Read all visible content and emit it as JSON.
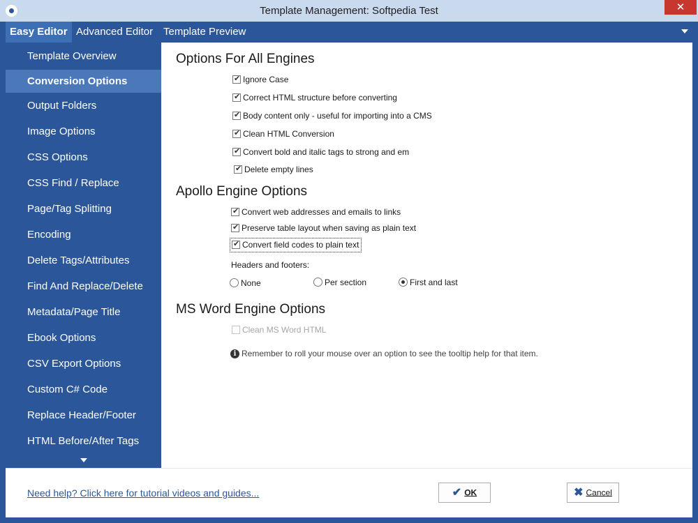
{
  "window": {
    "title": "Template Management: Softpedia Test",
    "close_label": "✕"
  },
  "menu": {
    "tabs": [
      {
        "label": "Easy Editor",
        "active": true
      },
      {
        "label": "Advanced Editor",
        "active": false
      },
      {
        "label": "Template Preview",
        "active": false
      }
    ]
  },
  "sidebar": {
    "items": [
      {
        "label": "Template Overview"
      },
      {
        "label": "Conversion Options",
        "active": true
      },
      {
        "label": "Output Folders"
      },
      {
        "label": "Image Options"
      },
      {
        "label": "CSS Options"
      },
      {
        "label": "CSS Find / Replace"
      },
      {
        "label": "Page/Tag Splitting"
      },
      {
        "label": "Encoding"
      },
      {
        "label": "Delete Tags/Attributes"
      },
      {
        "label": "Find And Replace/Delete"
      },
      {
        "label": "Metadata/Page Title"
      },
      {
        "label": "Ebook Options"
      },
      {
        "label": "CSV Export Options"
      },
      {
        "label": "Custom C# Code"
      },
      {
        "label": "Replace Header/Footer"
      },
      {
        "label": "HTML Before/After Tags"
      }
    ]
  },
  "main": {
    "all_engines": {
      "title": "Options For All Engines",
      "options": [
        {
          "label": "Ignore Case",
          "checked": true
        },
        {
          "label": "Correct HTML structure before converting",
          "checked": true
        },
        {
          "label": "Body content only - useful for importing into a CMS",
          "checked": true
        },
        {
          "label": "Clean HTML Conversion",
          "checked": true
        },
        {
          "label": "Convert bold and italic tags to strong and em",
          "checked": true
        },
        {
          "label": "Delete empty lines",
          "checked": true
        }
      ]
    },
    "apollo": {
      "title": "Apollo Engine Options",
      "options": [
        {
          "label": "Convert web addresses and emails to links",
          "checked": true
        },
        {
          "label": "Preserve table layout when saving as plain text",
          "checked": true
        },
        {
          "label": "Convert field codes to plain text",
          "checked": true
        }
      ],
      "headers_label": "Headers and footers:",
      "radios": [
        {
          "label": "None",
          "selected": false
        },
        {
          "label": "Per section",
          "selected": false
        },
        {
          "label": "First and last",
          "selected": true
        }
      ]
    },
    "msword": {
      "title": "MS Word Engine Options",
      "options": [
        {
          "label": "Clean MS Word HTML",
          "checked": false,
          "disabled": true
        }
      ]
    },
    "info_text": "Remember to roll your mouse over an option to see the tooltip help for that item."
  },
  "footer": {
    "help_link": "Need help? Click here for tutorial videos and guides...",
    "ok_label": "OK",
    "cancel_label": "Cancel"
  },
  "colors": {
    "accent": "#2b579a",
    "sidebar_active": "#4a78b9",
    "close": "#c7372f"
  }
}
